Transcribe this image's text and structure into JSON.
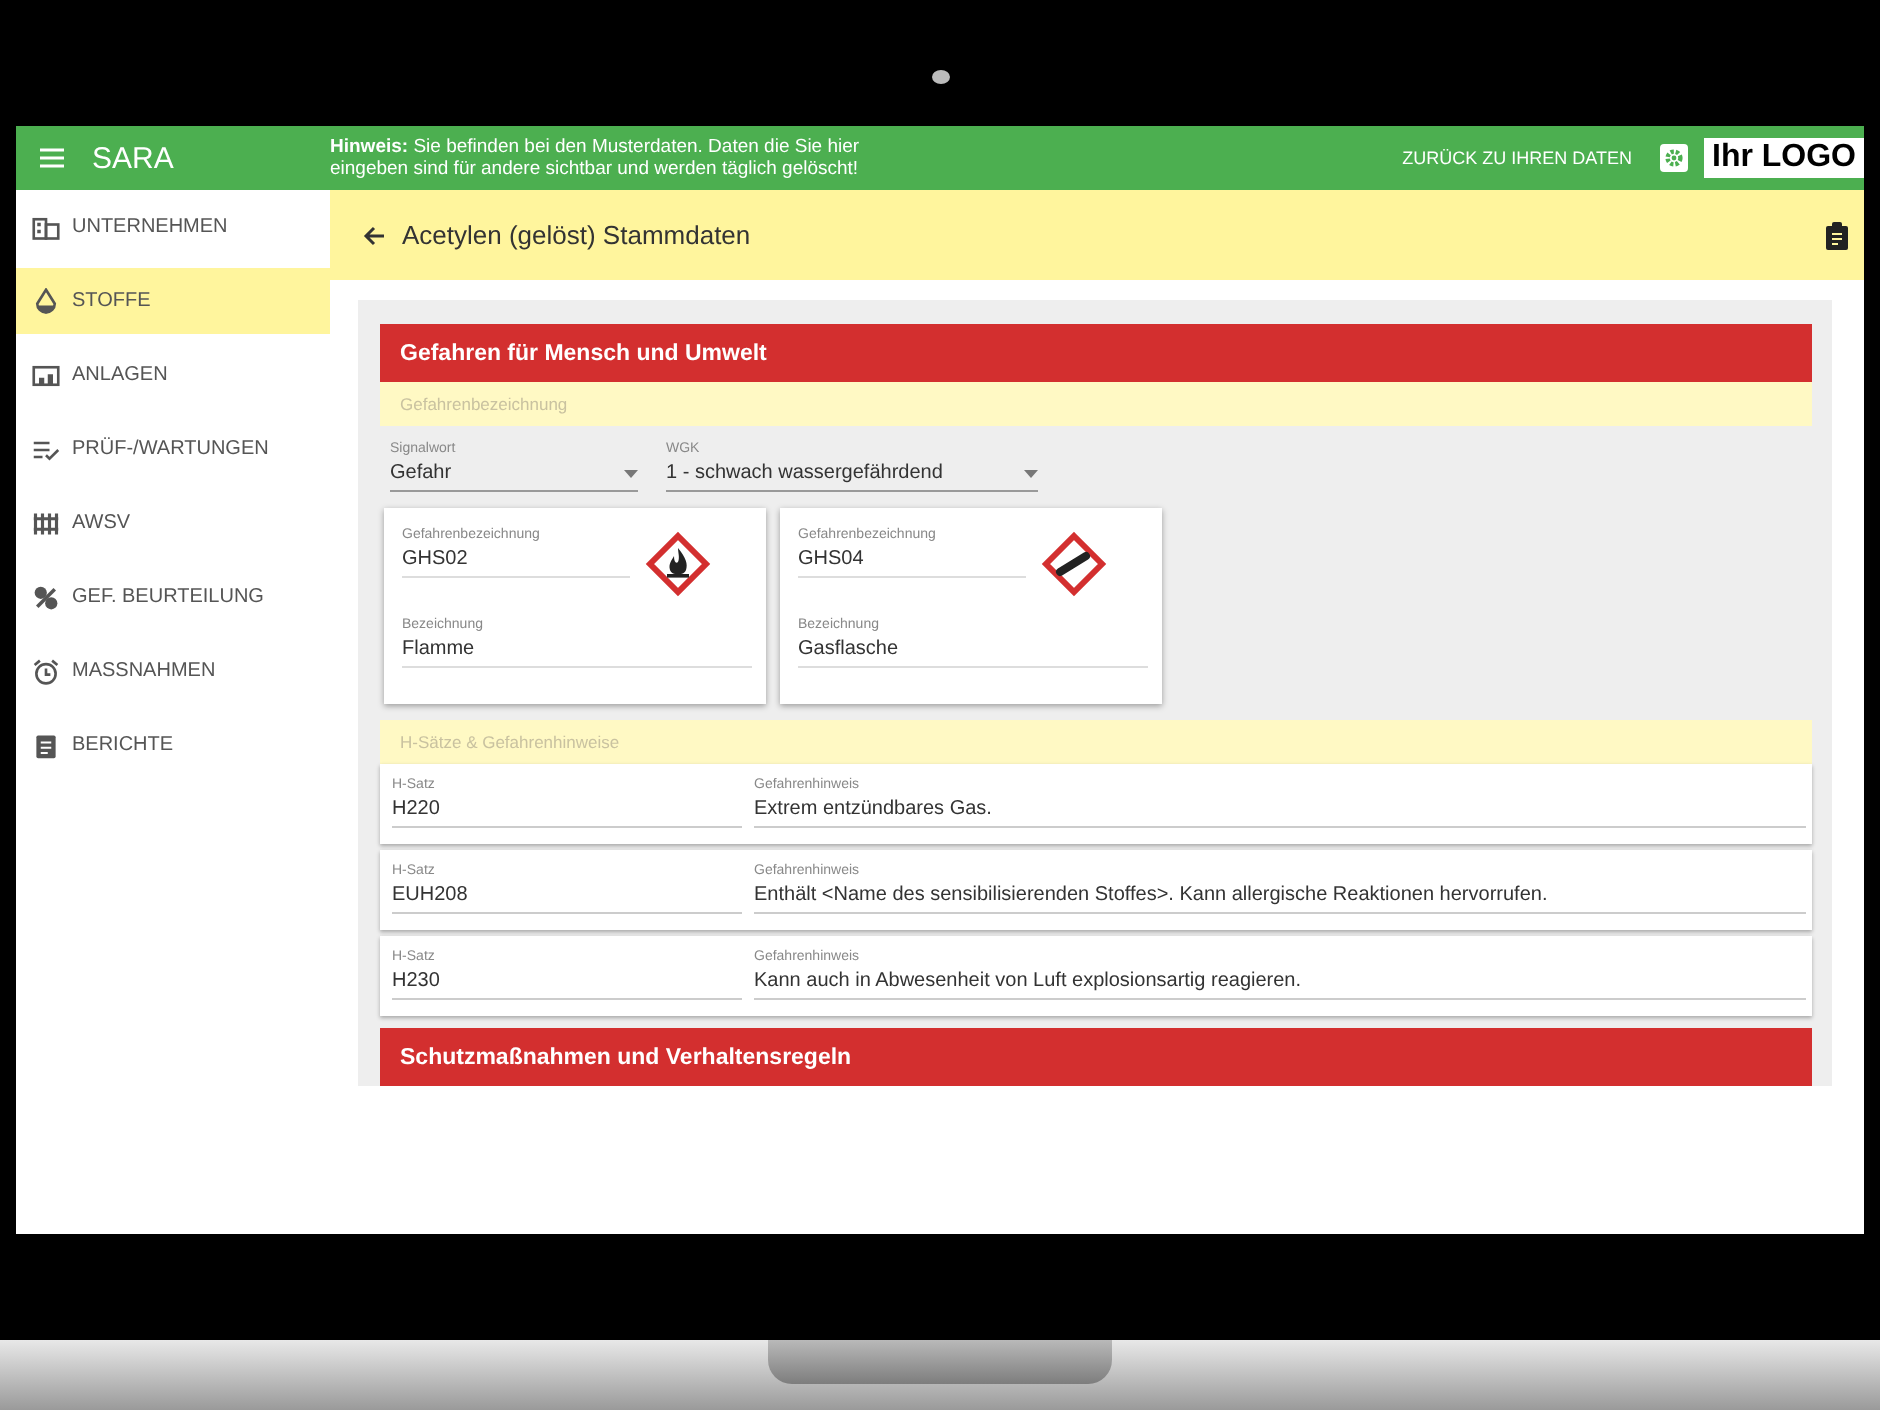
{
  "header": {
    "app_name": "SARA",
    "notice": "**Hinweis:** Sie befinden bei den Musterdaten. Daten die Sie hier\neingeben sind für andere sichtbar und werden täglich gelöscht!",
    "back_link": "ZURÜCK ZU IHREN DATEN",
    "logo": "Ihr LOGO"
  },
  "sidebar": {
    "items": [
      {
        "label": "UNTERNEHMEN",
        "kind": "building",
        "selected": false
      },
      {
        "label": "STOFFE",
        "kind": "drop",
        "selected": true
      },
      {
        "label": "ANLAGEN",
        "kind": "devices",
        "selected": false
      },
      {
        "label": "PRÜF-/WARTUNGEN",
        "kind": "checklist",
        "selected": false
      },
      {
        "label": "AWSV",
        "kind": "barrels",
        "selected": false
      },
      {
        "label": "GEF. BEURTEILUNG",
        "kind": "hazard",
        "selected": false
      },
      {
        "label": "MASSNAHMEN",
        "kind": "alarm",
        "selected": false
      },
      {
        "label": "BERICHTE",
        "kind": "report",
        "selected": false
      }
    ]
  },
  "page": {
    "title": "Acetylen (gelöst) Stammdaten"
  },
  "hazard_section": {
    "title": "Gefahren für Mensch und Umwelt",
    "subheading": "Gefahrenbezeichnung",
    "selects": [
      {
        "label": "Signalwort",
        "value": "Gefahr"
      },
      {
        "label": "WGK",
        "value": "1 - schwach wassergefährdend"
      }
    ],
    "pictograms": [
      {
        "code_label": "Gefahrenbezeichnung",
        "code": "GHS02",
        "name_label": "Bezeichnung",
        "name": "Flamme",
        "kind": "flame"
      },
      {
        "code_label": "Gefahrenbezeichnung",
        "code": "GHS04",
        "name_label": "Bezeichnung",
        "name": "Gasflasche",
        "kind": "gas-cylinder"
      }
    ],
    "h_subheading": "H-Sätze & Gefahrenhinweise",
    "h_statements": [
      {
        "code_label": "H-Satz",
        "code": "H220",
        "text_label": "Gefahrenhinweis",
        "text": "Extrem entzündbares Gas."
      },
      {
        "code_label": "H-Satz",
        "code": "EUH208",
        "text_label": "Gefahrenhinweis",
        "text": "Enthält <Name des sensibilisierenden Stoffes>. Kann allergische Reaktionen hervorrufen."
      },
      {
        "code_label": "H-Satz",
        "code": "H230",
        "text_label": "Gefahrenhinweis",
        "text": "Kann auch in Abwesenheit von Luft explosionsartig reagieren."
      }
    ]
  },
  "next_section": {
    "title": "Schutzmaßnahmen und Verhaltensregeln"
  }
}
